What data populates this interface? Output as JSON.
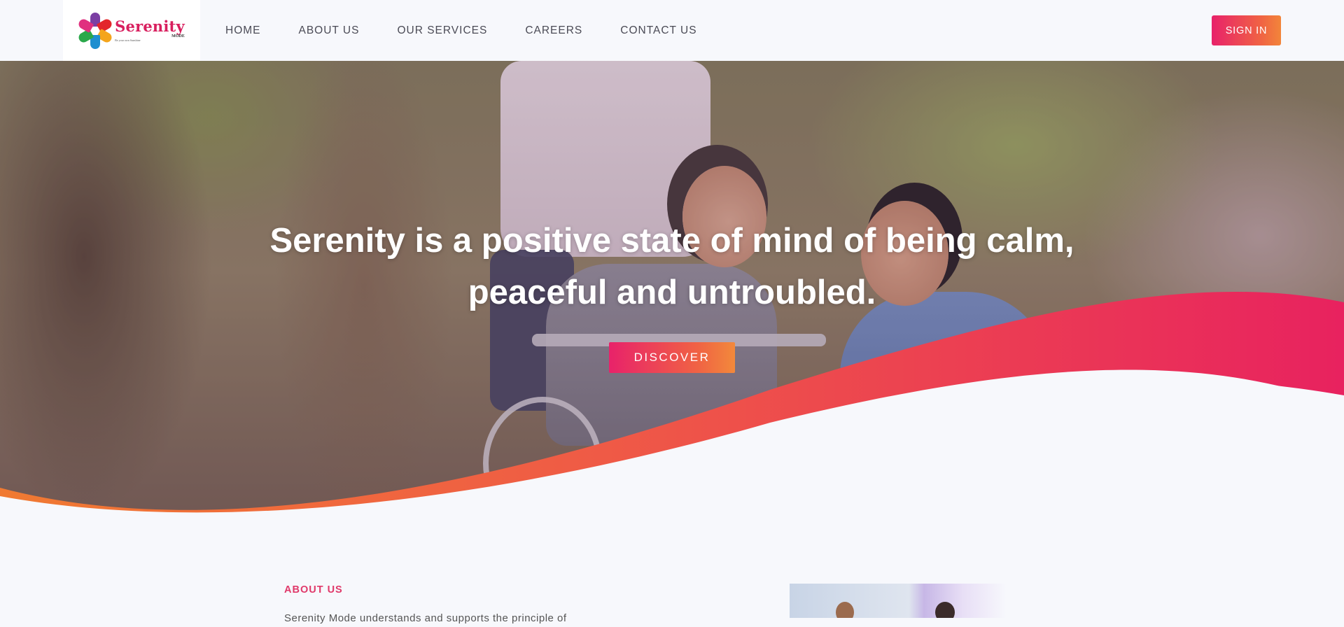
{
  "brand": {
    "name": "Serenity",
    "sub": "MODE",
    "tagline": "Be your own Sunshine"
  },
  "nav": {
    "items": [
      {
        "label": "HOME"
      },
      {
        "label": "ABOUT US"
      },
      {
        "label": "OUR SERVICES"
      },
      {
        "label": "CAREERS"
      },
      {
        "label": "CONTACT US"
      }
    ],
    "signin_label": "SIGN IN"
  },
  "hero": {
    "headline_line1": "Serenity is a positive state of mind of being calm,",
    "headline_line2": "peaceful and untroubled.",
    "cta_label": "DISCOVER"
  },
  "about": {
    "label": "ABOUT US",
    "text": "Serenity Mode understands and supports the principle of"
  },
  "colors": {
    "accent_pink": "#e8226a",
    "accent_orange": "#f2853a",
    "page_bg": "#f7f8fc"
  }
}
